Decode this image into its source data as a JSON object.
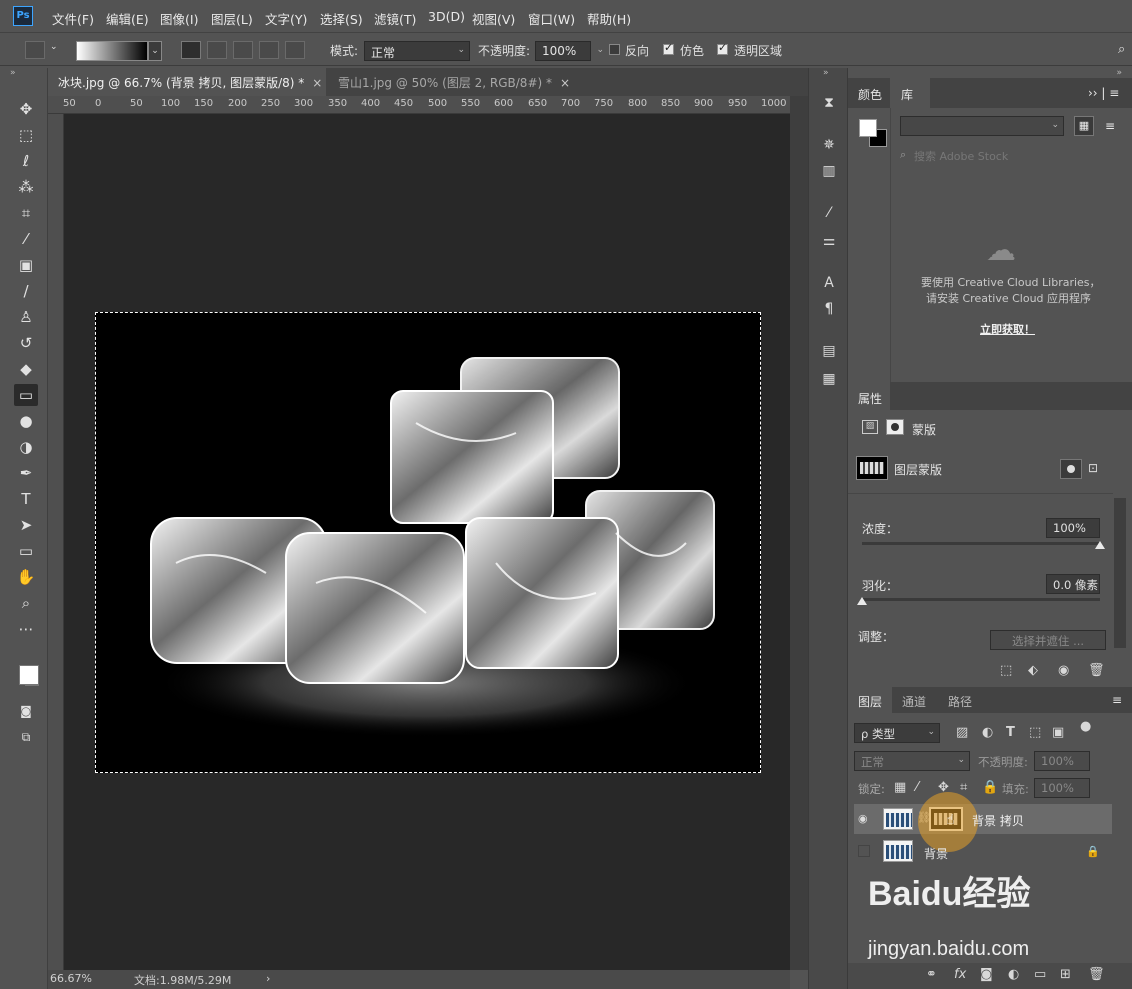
{
  "app": {
    "logo": "Ps"
  },
  "menu": [
    "文件(F)",
    "编辑(E)",
    "图像(I)",
    "图层(L)",
    "文字(Y)",
    "选择(S)",
    "滤镜(T)",
    "3D(D)",
    "视图(V)",
    "窗口(W)",
    "帮助(H)"
  ],
  "options": {
    "mode_label": "模式:",
    "mode_value": "正常",
    "opacity_label": "不透明度:",
    "opacity_value": "100%",
    "reverse_label": "反向",
    "reverse_checked": false,
    "dither_label": "仿色",
    "dither_checked": true,
    "transparency_label": "透明区域",
    "transparency_checked": true
  },
  "tabs": [
    {
      "label": "冰块.jpg @ 66.7% (背景 拷贝, 图层蒙版/8) *",
      "close": "×"
    },
    {
      "label": "雪山1.jpg @ 50% (图层 2, RGB/8#) *",
      "close": "×"
    }
  ],
  "ruler_marks": [
    "50",
    "0",
    "50",
    "100",
    "150",
    "200",
    "250",
    "300",
    "350",
    "400",
    "450",
    "500",
    "550",
    "600",
    "650",
    "700",
    "750",
    "800",
    "850",
    "900",
    "950",
    "1000"
  ],
  "status": {
    "zoom": "66.67%",
    "doc": "文档:1.98M/5.29M",
    "arrow": "›"
  },
  "color_panel": {
    "tab_color": "颜色",
    "tab_library": "库",
    "fg_color": "#ffffff",
    "bg_color": "#000000"
  },
  "library": {
    "search_placeholder": "搜索 Adobe Stock",
    "message_line1": "要使用 Creative Cloud Libraries，",
    "message_line2": "请安装 Creative Cloud 应用程序",
    "link": "立即获取！"
  },
  "properties": {
    "title": "属性",
    "mask_label": "蒙版",
    "layer_mask_label": "图层蒙版",
    "density_label": "浓度：",
    "density_value": "100%",
    "density_fraction": 1.0,
    "feather_label": "羽化：",
    "feather_value": "0.0 像素",
    "feather_fraction": 0.0,
    "adjust_label": "调整：",
    "select_mask_button": "选择并遮住 ..."
  },
  "layers_panel": {
    "tabs": [
      "图层",
      "通道",
      "路径"
    ],
    "filter_label": "ρ 类型",
    "blend_mode": "正常",
    "opacity_label": "不透明度:",
    "opacity_value": "100%",
    "lock_label": "锁定:",
    "fill_label": "填充:",
    "fill_value": "100%",
    "layers": [
      {
        "name": "背景 拷贝",
        "visible": true,
        "selected": true
      },
      {
        "name": "背景",
        "visible": false,
        "selected": false
      }
    ]
  },
  "watermark": {
    "logo": "Baidu经验",
    "url": "jingyan.baidu.com"
  }
}
